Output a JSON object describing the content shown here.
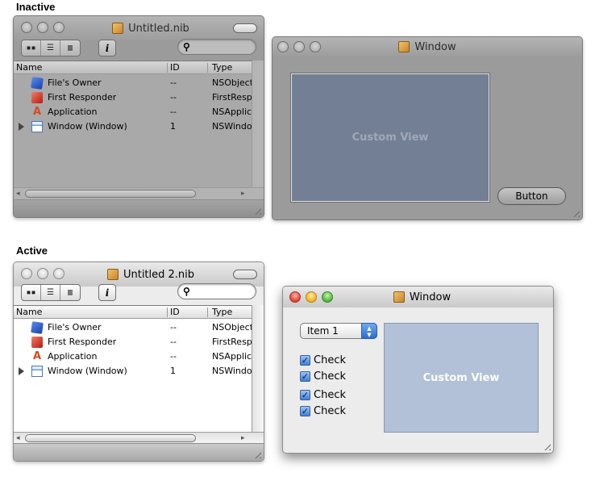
{
  "sections": {
    "inactive_label": "Inactive",
    "active_label": "Active"
  },
  "inactive_nib": {
    "title": "Untitled.nib",
    "columns": {
      "name": "Name",
      "id": "ID",
      "type": "Type"
    },
    "rows": [
      {
        "name": "File's Owner",
        "id": "--",
        "type": "NSObject",
        "icon": "cube-icon"
      },
      {
        "name": "First Responder",
        "id": "--",
        "type": "FirstResp",
        "icon": "first-responder-icon"
      },
      {
        "name": "Application",
        "id": "--",
        "type": "NSApplic",
        "icon": "application-icon"
      },
      {
        "name": "Window (Window)",
        "id": "1",
        "type": "NSWindow",
        "icon": "window-icon"
      }
    ]
  },
  "inactive_window": {
    "title": "Window",
    "custom_view_label": "Custom View",
    "button_label": "Button"
  },
  "active_nib": {
    "title": "Untitled 2.nib",
    "columns": {
      "name": "Name",
      "id": "ID",
      "type": "Type"
    },
    "rows": [
      {
        "name": "File's Owner",
        "id": "--",
        "type": "NSObject",
        "icon": "cube-icon"
      },
      {
        "name": "First Responder",
        "id": "--",
        "type": "FirstResp",
        "icon": "first-responder-icon"
      },
      {
        "name": "Application",
        "id": "--",
        "type": "NSApplic",
        "icon": "application-icon"
      },
      {
        "name": "Window (Window)",
        "id": "1",
        "type": "NSWindow",
        "icon": "window-icon"
      }
    ]
  },
  "active_window": {
    "title": "Window",
    "popup_value": "Item 1",
    "checks": [
      {
        "label": "Check",
        "checked": true
      },
      {
        "label": "Check",
        "checked": true
      },
      {
        "label": "Check",
        "checked": true
      },
      {
        "label": "Check",
        "checked": true
      }
    ],
    "custom_view_label": "Custom View"
  },
  "colors": {
    "inactive_window_bg": "#9b9b9b",
    "custom_view_inactive": "#727f95",
    "custom_view_active": "#b2c0d8",
    "close_button": "#e0402f",
    "minimize_button": "#efb228",
    "zoom_button": "#4fb33a"
  }
}
